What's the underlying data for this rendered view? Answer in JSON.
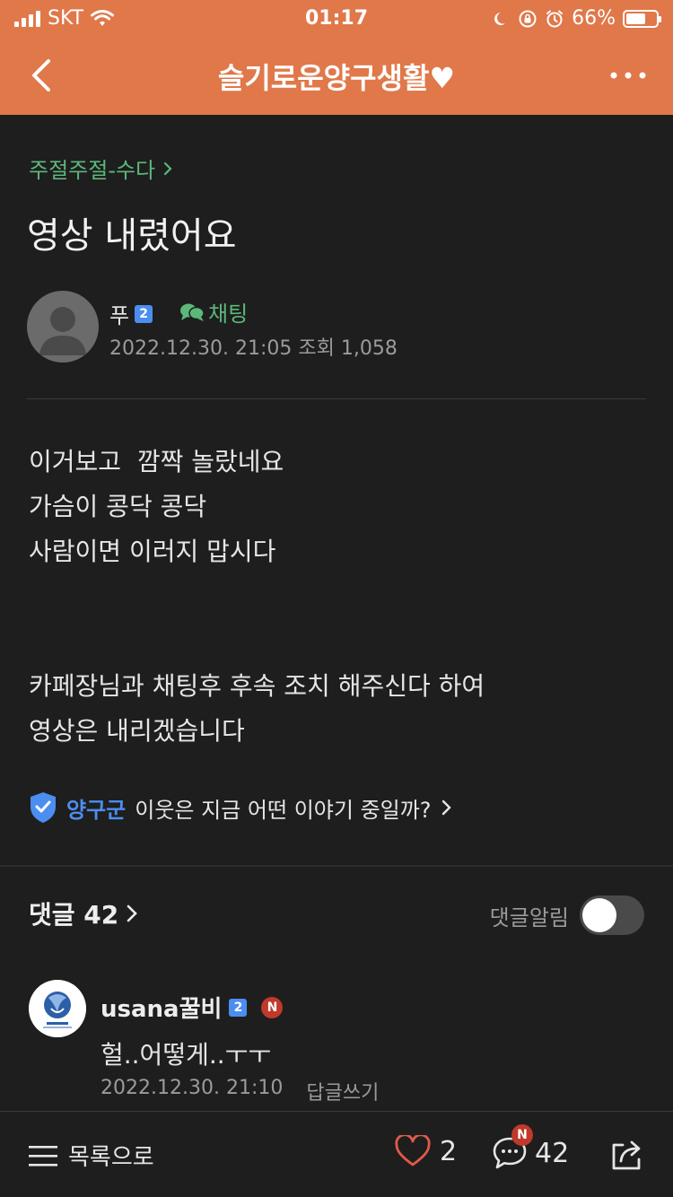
{
  "status_bar": {
    "carrier": "SKT",
    "time": "01:17",
    "battery": "66%",
    "battery_level": 0.66
  },
  "header": {
    "title": "슬기로운양구생활♥"
  },
  "post": {
    "breadcrumb": "주절주절-수다",
    "title": "영상 내렸어요",
    "author": "푸",
    "author_level": "2",
    "chat_label": "채팅",
    "date": "2022.12.30. 21:05",
    "views": "조회 1,058",
    "body_lines_1": [
      "이거보고  깜짝 놀랐네요",
      "가슴이 콩닥 콩닥",
      "사람이면 이러지 맙시다"
    ],
    "body_lines_2": [
      "카페장님과 채팅후 후속 조치 해주신다 하여",
      "영상은 내리겠습니다"
    ]
  },
  "neighbor": {
    "tag": "양구군",
    "text": "이웃은 지금 어떤 이야기 중일까?"
  },
  "comments": {
    "header": "댓글 42",
    "notify_label": "댓글알림",
    "notify_on": false,
    "items": [
      {
        "author": "usana꿀비",
        "level": "2",
        "new_badge": "N",
        "text": "헐..어떻게..ㅜㅜ",
        "date": "2022.12.30. 21:10",
        "reply": "답글쓰기"
      }
    ]
  },
  "bottom_bar": {
    "list_label": "목록으로",
    "likes": "2",
    "comments": "42",
    "comment_badge": "N"
  },
  "colors": {
    "header_bg": "#e0784a",
    "accent_green": "#5cb87a",
    "accent_blue": "#4b8ef0",
    "bg": "#1e1e1e"
  }
}
